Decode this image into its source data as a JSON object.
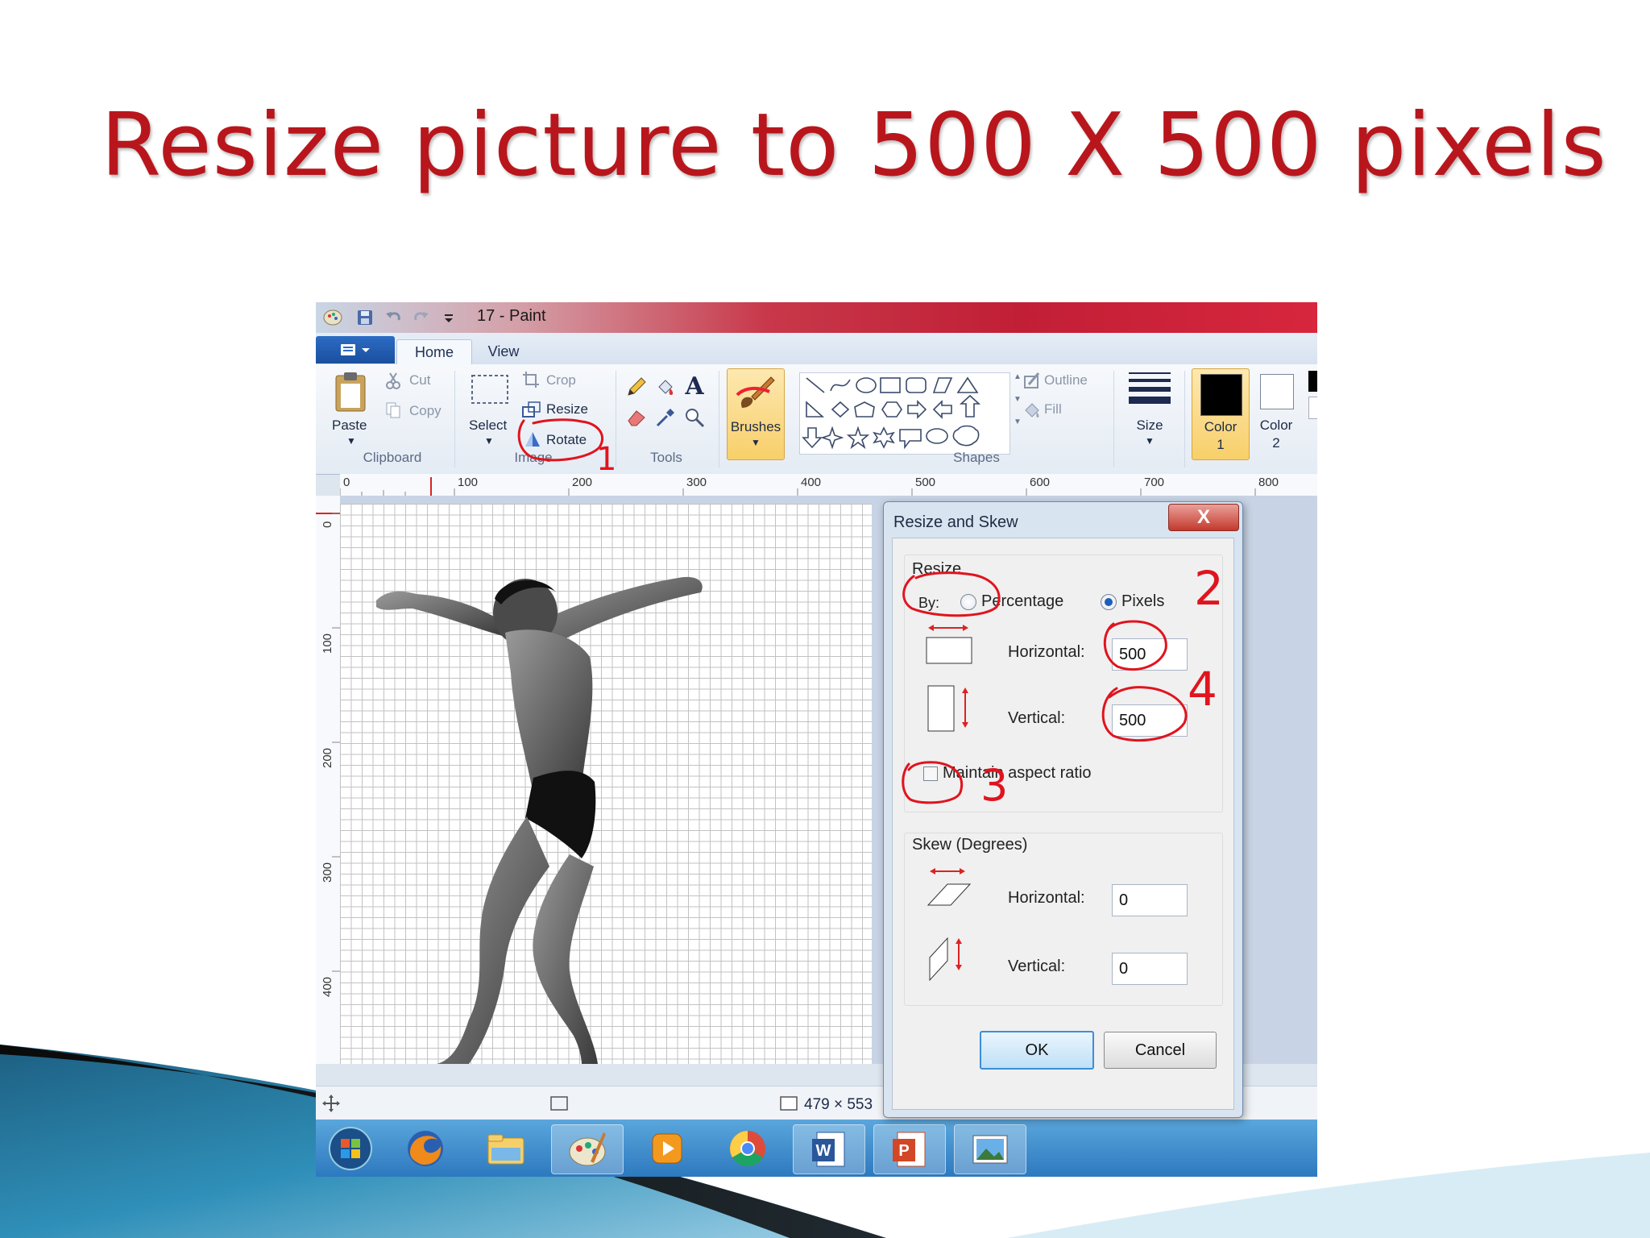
{
  "slide": {
    "title": "Resize picture to 500 X 500 pixels"
  },
  "window": {
    "title": "17 - Paint",
    "file_menu_icon": "paint-menu-icon",
    "tabs": [
      {
        "label": "Home",
        "active": true
      },
      {
        "label": "View",
        "active": false
      }
    ]
  },
  "ribbon": {
    "clipboard": {
      "paste": "Paste",
      "cut": "Cut",
      "copy": "Copy",
      "group": "Clipboard"
    },
    "image": {
      "select": "Select",
      "crop": "Crop",
      "resize": "Resize",
      "rotate": "Rotate",
      "group": "Image"
    },
    "tools": {
      "group": "Tools",
      "text_tool": "A"
    },
    "brushes": {
      "label": "Brushes"
    },
    "shapes": {
      "outline": "Outline",
      "fill": "Fill",
      "group": "Shapes"
    },
    "size": {
      "label": "Size"
    },
    "color1": {
      "label": "Color",
      "number": "1",
      "swatch": "#000000"
    },
    "color2": {
      "label": "Color",
      "number": "2",
      "swatch": "#ffffff"
    }
  },
  "rulers": {
    "horizontal": [
      "0",
      "100",
      "200",
      "300",
      "400",
      "500",
      "600",
      "700",
      "800"
    ],
    "vertical": [
      "0",
      "100",
      "200",
      "300",
      "400"
    ]
  },
  "status": {
    "image_size": "479 × 553"
  },
  "dialog": {
    "title": "Resize and Skew",
    "close": "X",
    "resize_section": "Resize",
    "by_label": "By:",
    "percentage": "Percentage",
    "pixels": "Pixels",
    "selected_mode": "pixels",
    "horizontal_label": "Horizontal:",
    "horizontal_value": "500",
    "vertical_label": "Vertical:",
    "vertical_value": "500",
    "maintain_aspect": "Maintain aspect ratio",
    "maintain_aspect_checked": false,
    "skew_section": "Skew (Degrees)",
    "skew_horizontal_label": "Horizontal:",
    "skew_horizontal_value": "0",
    "skew_vertical_label": "Vertical:",
    "skew_vertical_value": "0",
    "ok": "OK",
    "cancel": "Cancel"
  },
  "annotations": {
    "step1": "1",
    "step2": "2",
    "step3": "3",
    "step4": "4",
    "color": "#e0141e"
  },
  "taskbar": {
    "items": [
      "start-orb-icon",
      "firefox-icon",
      "file-explorer-icon",
      "paint-icon",
      "media-player-icon",
      "chrome-icon",
      "word-icon",
      "powerpoint-icon",
      "photo-viewer-icon"
    ]
  }
}
